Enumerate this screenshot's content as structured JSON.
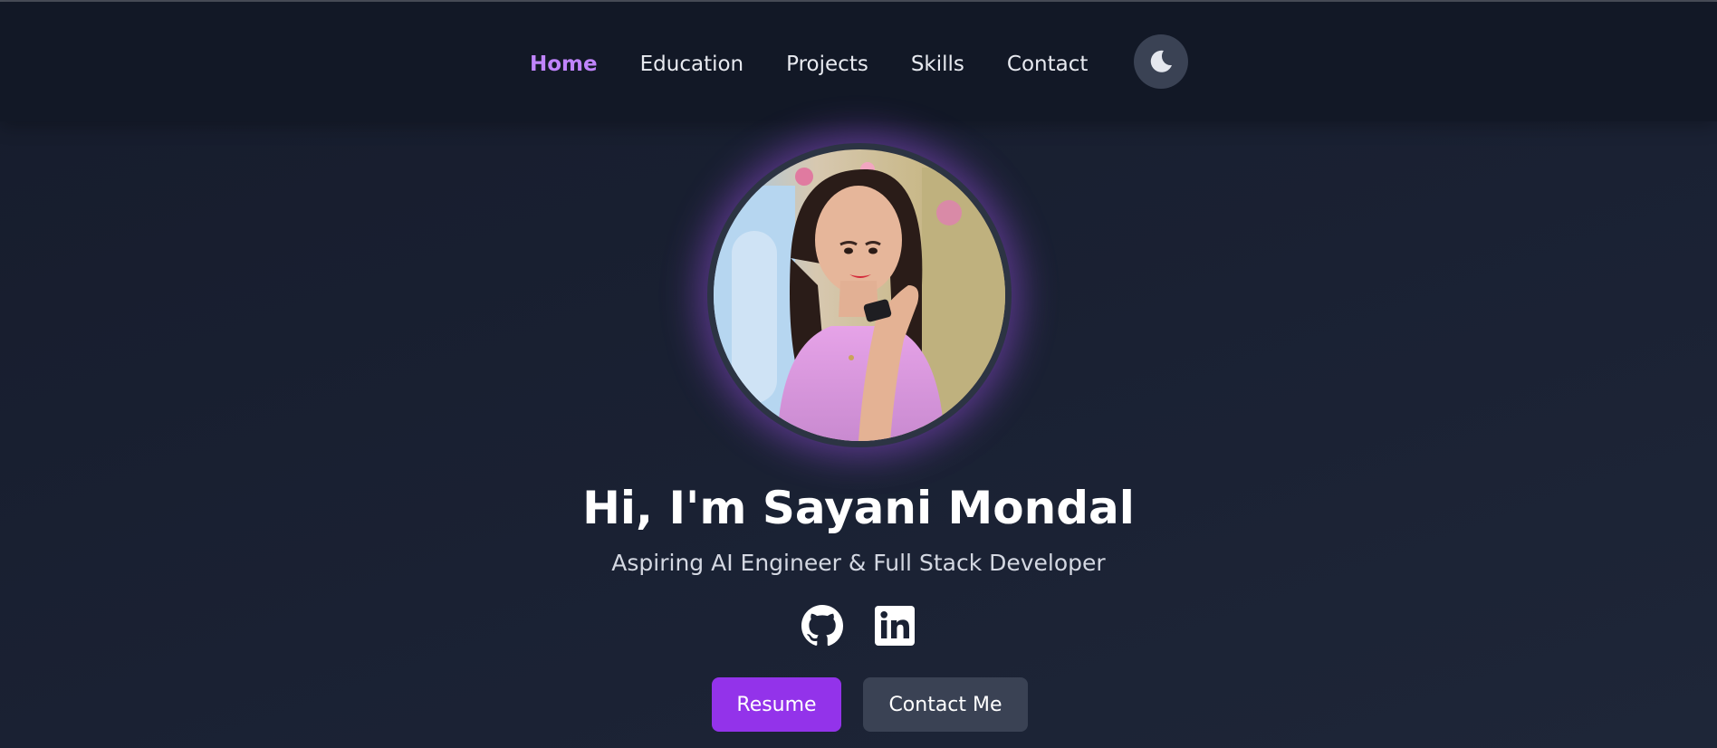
{
  "nav": {
    "items": [
      {
        "label": "Home",
        "active": true
      },
      {
        "label": "Education",
        "active": false
      },
      {
        "label": "Projects",
        "active": false
      },
      {
        "label": "Skills",
        "active": false
      },
      {
        "label": "Contact",
        "active": false
      }
    ],
    "theme_toggle_icon": "moon-icon"
  },
  "hero": {
    "avatar_alt": "profile photo",
    "title": "Hi, I'm Sayani Mondal",
    "subtitle": "Aspiring AI Engineer & Full Stack Developer",
    "social": [
      {
        "icon": "github-icon"
      },
      {
        "icon": "linkedin-icon"
      }
    ],
    "primary_button": "Resume",
    "secondary_button": "Contact Me"
  },
  "colors": {
    "accent": "#9333ea",
    "nav_active": "#c084fc",
    "background": "#1a2133",
    "navbar": "#121826",
    "secondary_button": "#3a4254"
  }
}
